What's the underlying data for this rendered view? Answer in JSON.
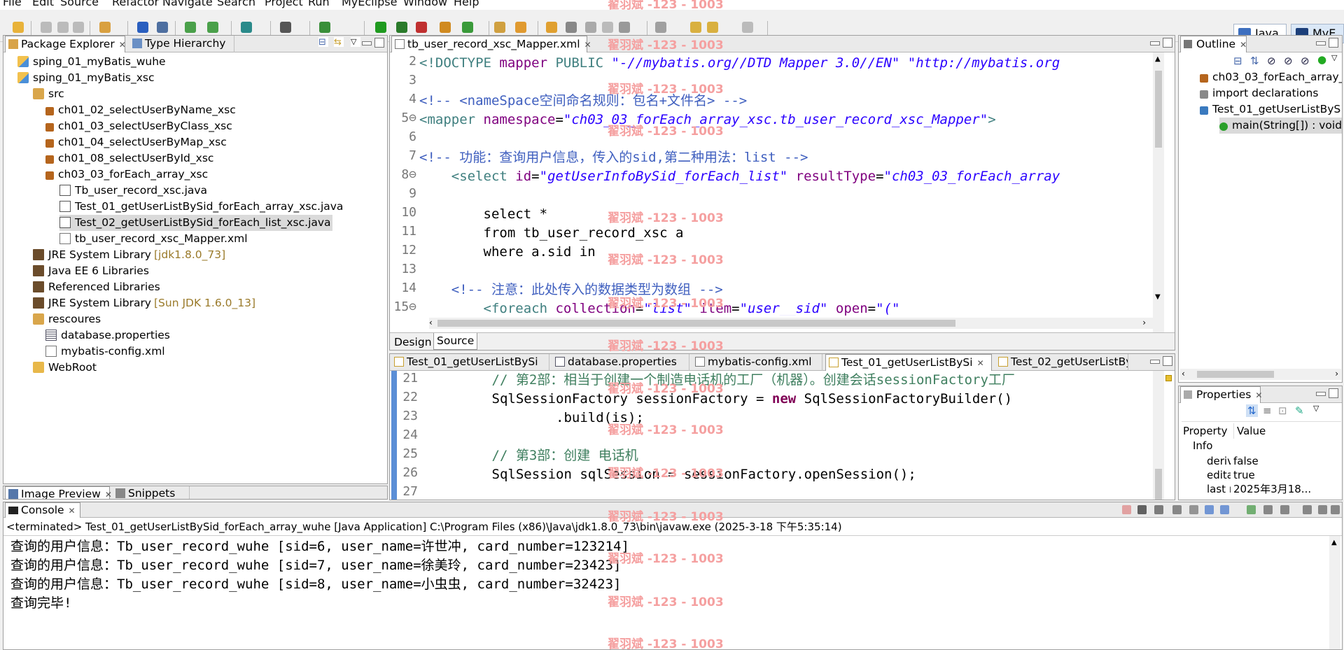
{
  "menu": [
    "File",
    "Edit",
    "Source",
    "Refactor",
    "Navigate",
    "Search",
    "Project",
    "Run",
    "MyEclipse",
    "Window",
    "Help"
  ],
  "perspectives": [
    "Java",
    "MyE"
  ],
  "watermark": "翟羽斌 -123 - 1003",
  "package_explorer": {
    "tabs": [
      "Package Explorer",
      "Type Hierarchy"
    ],
    "items": [
      {
        "label": "sping_01_myBatis_wuhe",
        "icon": "project-icon"
      },
      {
        "label": "sping_01_myBatis_xsc",
        "icon": "project-icon"
      },
      {
        "label": "src",
        "icon": "source-folder-icon"
      },
      {
        "label": "ch01_02_selectUserByName_xsc",
        "icon": "package-icon"
      },
      {
        "label": "ch01_03_selectUserByClass_xsc",
        "icon": "package-icon"
      },
      {
        "label": "ch01_04_selectUserByMap_xsc",
        "icon": "package-icon"
      },
      {
        "label": "ch01_08_selectUserById_xsc",
        "icon": "package-icon"
      },
      {
        "label": "ch03_03_forEach_array_xsc",
        "icon": "package-icon"
      },
      {
        "label": "Tb_user_record_xsc.java",
        "icon": "java-file-icon"
      },
      {
        "label": "Test_01_getUserListBySid_forEach_array_xsc.java",
        "icon": "java-file-icon"
      },
      {
        "label": "Test_02_getUserListBySid_forEach_list_xsc.java",
        "icon": "java-file-icon"
      },
      {
        "label": "tb_user_record_xsc_Mapper.xml",
        "icon": "xml-file-icon"
      },
      {
        "label": "JRE System Library",
        "suffix": "[jdk1.8.0_73]",
        "icon": "library-icon"
      },
      {
        "label": "Java EE 6 Libraries",
        "icon": "library-icon"
      },
      {
        "label": "Referenced Libraries",
        "icon": "library-icon"
      },
      {
        "label": "JRE System Library",
        "suffix": "[Sun JDK 1.6.0_13]",
        "icon": "library-icon"
      },
      {
        "label": "rescoures",
        "icon": "source-folder-icon"
      },
      {
        "label": "database.properties",
        "icon": "properties-file-icon"
      },
      {
        "label": "mybatis-config.xml",
        "icon": "xml-file-icon"
      },
      {
        "label": "WebRoot",
        "icon": "folder-icon"
      }
    ]
  },
  "bottom_left_tabs": [
    "Image Preview",
    "Snippets"
  ],
  "editor_top": {
    "tab": "tb_user_record_xsc_Mapper.xml",
    "lines": [
      {
        "n": "2",
        "parts": [
          [
            "tag",
            "<!DOCTYPE "
          ],
          [
            "attr",
            "mapper "
          ],
          [
            "tag",
            "PUBLIC "
          ],
          [
            "val",
            "\"-//mybatis.org//DTD Mapper 3.0//EN\" \"http://mybatis.org"
          ]
        ]
      },
      {
        "n": "3",
        "parts": []
      },
      {
        "n": "4",
        "parts": [
          [
            "cm",
            "<!-- <nameSpace空间命名规则：包名+文件名> -->"
          ]
        ]
      },
      {
        "n": "5⊖",
        "parts": [
          [
            "tag",
            "<mapper "
          ],
          [
            "attr",
            "namespace"
          ],
          [
            "",
            "="
          ],
          [
            "val",
            "\"ch03_03_forEach_array_xsc.tb_user_record_xsc_Mapper\""
          ],
          [
            "tag",
            ">"
          ]
        ]
      },
      {
        "n": "6",
        "parts": []
      },
      {
        "n": "7",
        "parts": [
          [
            "cm",
            "<!-- 功能：查询用户信息，传入的sid,第二种用法：list -->"
          ]
        ]
      },
      {
        "n": "8⊖",
        "parts": [
          [
            "tag",
            "    <select "
          ],
          [
            "attr",
            "id"
          ],
          [
            "",
            "="
          ],
          [
            "val",
            "\"getUserInfoBySid_forEach_list\" "
          ],
          [
            "attr",
            "resultType"
          ],
          [
            "",
            "="
          ],
          [
            "val",
            "\"ch03_03_forEach_array"
          ]
        ]
      },
      {
        "n": "9",
        "parts": []
      },
      {
        "n": "10",
        "parts": [
          [
            "",
            "        select *"
          ]
        ]
      },
      {
        "n": "11",
        "parts": [
          [
            "",
            "        from tb_user_record_xsc a"
          ]
        ]
      },
      {
        "n": "12",
        "parts": [
          [
            "",
            "        where a.sid in"
          ]
        ]
      },
      {
        "n": "13",
        "parts": []
      },
      {
        "n": "14",
        "parts": [
          [
            "cm",
            "    <!-- 注意：此处传入的数据类型为数组 -->"
          ]
        ]
      },
      {
        "n": "15⊖",
        "parts": [
          [
            "tag",
            "        <foreach "
          ],
          [
            "attr",
            "collection"
          ],
          [
            "",
            "="
          ],
          [
            "val",
            "\"list\" "
          ],
          [
            "attr",
            "item"
          ],
          [
            "",
            "="
          ],
          [
            "val",
            "\"user__sid\" "
          ],
          [
            "attr",
            "open"
          ],
          [
            "",
            "="
          ],
          [
            "val",
            "\"(\""
          ]
        ]
      }
    ],
    "bottom_tabs": [
      "Design",
      "Source"
    ]
  },
  "editor_bottom": {
    "tabs": [
      "Test_01_getUserListBySi",
      "database.properties",
      "mybatis-config.xml",
      "Test_01_getUserListBySi",
      "Test_02_getUserListBySi"
    ],
    "lines": [
      {
        "n": "21",
        "parts": [
          [
            "gcm",
            "        // 第2部：相当于创建一个制造电话机的工厂（机器）。创建会话sessionFactory工厂"
          ]
        ]
      },
      {
        "n": "22",
        "parts": [
          [
            "",
            "        SqlSessionFactory sessionFactory = "
          ],
          [
            "kw",
            "new"
          ],
          [
            "",
            " SqlSessionFactoryBuilder()"
          ]
        ]
      },
      {
        "n": "23",
        "parts": [
          [
            "",
            "                .build(is);"
          ]
        ]
      },
      {
        "n": "24",
        "parts": []
      },
      {
        "n": "25",
        "parts": [
          [
            "gcm",
            "        // 第3部：创建 电话机"
          ]
        ]
      },
      {
        "n": "26",
        "parts": [
          [
            "",
            "        SqlSession sqlSession = sessionFactory.openSession();"
          ]
        ]
      },
      {
        "n": "27",
        "parts": []
      }
    ]
  },
  "outline": {
    "tab": "Outline",
    "items": [
      {
        "label": "ch03_03_forEach_array_",
        "icon": "package-icon"
      },
      {
        "label": "import declarations",
        "icon": "imports-icon"
      },
      {
        "label": "Test_01_getUserListByS",
        "icon": "class-icon"
      },
      {
        "label": "main(String[]) : void",
        "icon": "method-icon"
      }
    ]
  },
  "properties": {
    "tab": "Properties",
    "headers": [
      "Property",
      "Value"
    ],
    "group": "Info",
    "rows": [
      [
        "deriv",
        "false"
      ],
      [
        "edita",
        "true"
      ],
      [
        "last r",
        "2025年3月18..."
      ]
    ]
  },
  "console": {
    "tab": "Console",
    "header": "<terminated> Test_01_getUserListBySid_forEach_array_wuhe [Java Application] C:\\Program Files (x86)\\Java\\jdk1.8.0_73\\bin\\javaw.exe (2025-3-18 下午5:35:14)",
    "lines": [
      "查询的用户信息：Tb_user_record_wuhe [sid=6, user_name=许世冲, card_number=123214]",
      "查询的用户信息：Tb_user_record_wuhe [sid=7, user_name=徐美玲, card_number=23423]",
      "查询的用户信息：Tb_user_record_wuhe [sid=8, user_name=小虫虫, card_number=32423]",
      "查询完毕!"
    ]
  }
}
